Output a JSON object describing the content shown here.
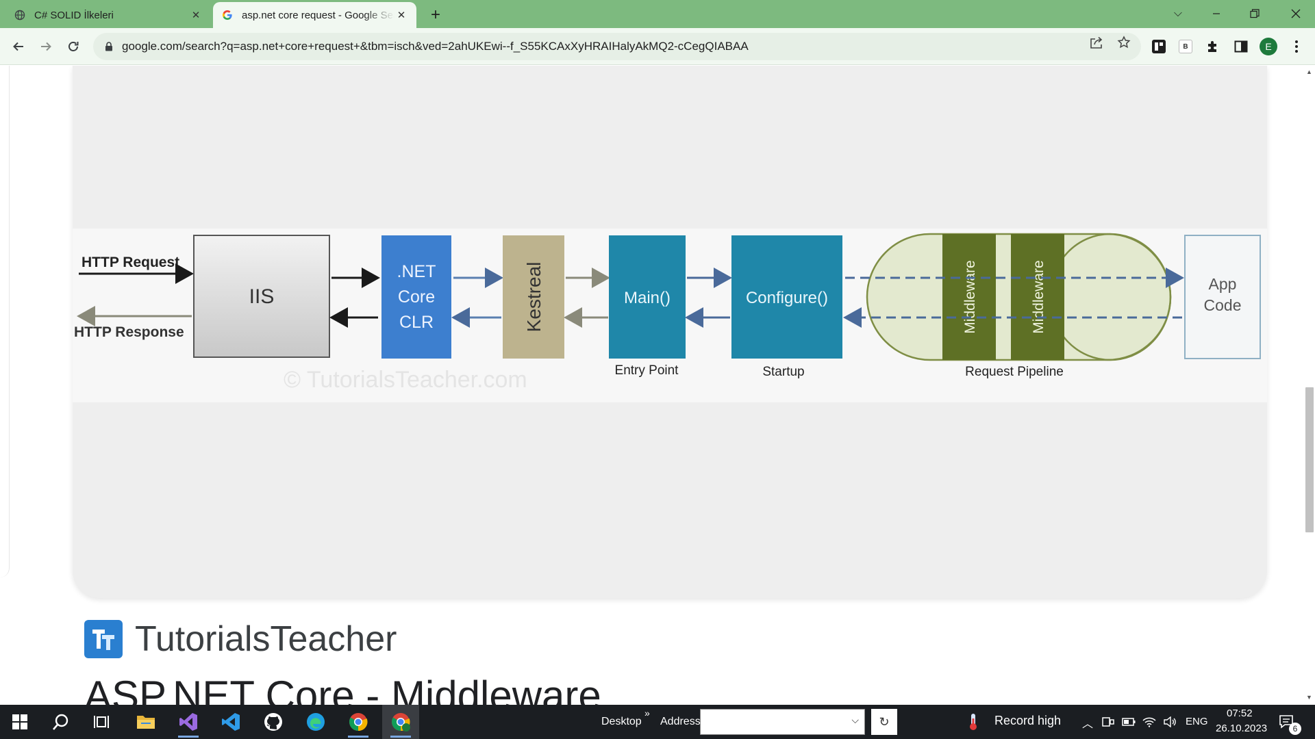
{
  "browser": {
    "tabs": [
      {
        "title": "C# SOLID İlkeleri",
        "active": false
      },
      {
        "title": "asp.net core request - Google Search",
        "active": true
      }
    ],
    "url": "google.com/search?q=asp.net+core+request+&tbm=isch&ved=2ahUKEwi--f_S55KCAxXyHRAIHalyAkMQ2-cCegQIABAA",
    "profile_initial": "E",
    "ext_badge": "B",
    "accent_color": "#7dba7f"
  },
  "diagram": {
    "http_request": "HTTP Request",
    "http_response": "HTTP Response",
    "iis": "IIS",
    "clr_lines": [
      ".NET",
      "Core",
      "CLR"
    ],
    "kestrel": "Kestreal",
    "main": "Main()",
    "configure": "Configure()",
    "middleware_1": "Middleware",
    "middleware_2": "Middleware",
    "app_code_lines": [
      "App",
      "Code"
    ],
    "entry_point": "Entry Point",
    "startup": "Startup",
    "request_pipeline": "Request Pipeline",
    "watermark": "© TutorialsTeacher.com"
  },
  "result": {
    "site_name": "TutorialsTeacher",
    "heading": "ASP.NET Core - Middleware"
  },
  "taskbar": {
    "desktop_label": "Desktop",
    "chevron": "»",
    "address_label": "Address",
    "weather": "Record high",
    "language": "ENG",
    "time": "07:52",
    "date": "26.10.2023",
    "notification_count": "6"
  }
}
